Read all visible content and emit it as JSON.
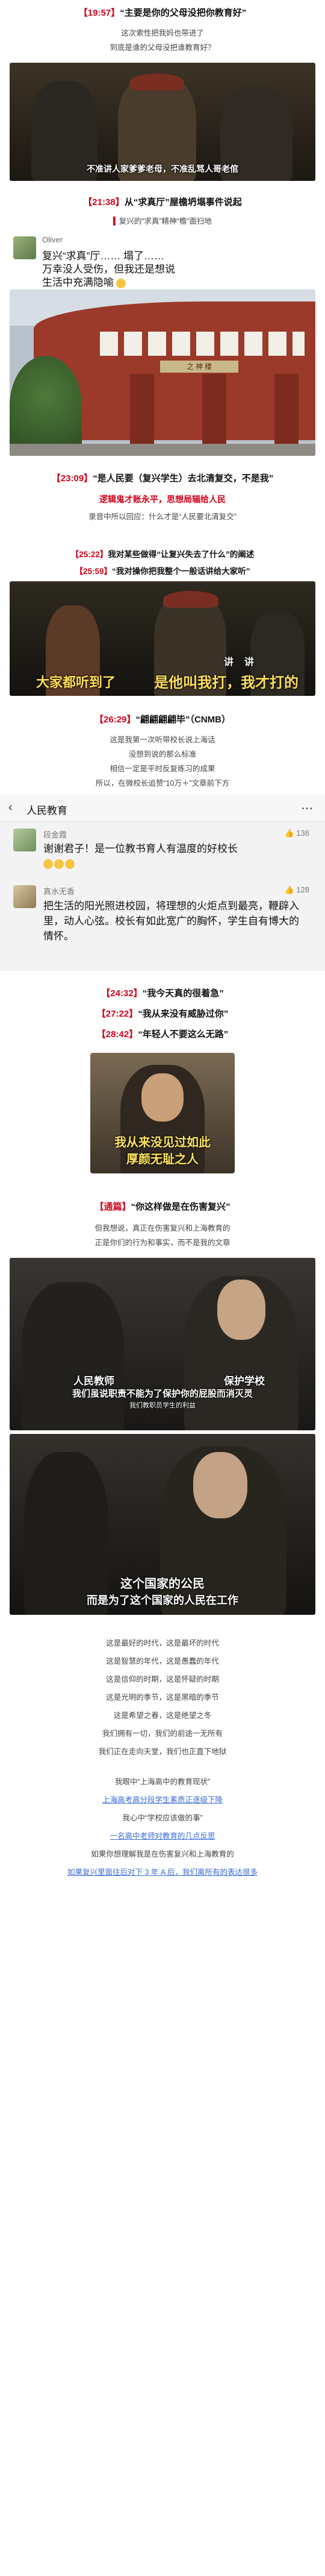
{
  "sec1": {
    "time": "19:57",
    "title_text": "“主要是你的父母没把你教育好”",
    "lines": [
      "这次索性把我妈也带进了",
      "到底是谁的父母没把谁教育好？"
    ],
    "subtitle": "不准讲人家爹爹老母，不准乱骂人哥老倌"
  },
  "sec2": {
    "time": "21:38",
    "title_text": "从“求真厅”屋檐坍塌事件说起",
    "note": "复兴的“求真”精神“檐”面扫地",
    "user": "Oliver",
    "comment": [
      "复兴“求真”厅…… 塌了……",
      "万幸没人受伤，但我还是想说",
      "生活中充满隐喻"
    ],
    "sign": "之 神 楼"
  },
  "sec3": {
    "time": "23:09",
    "title_text": "“是人民要（复兴学生）去北清复交，不是我”",
    "quote": [
      "逻辑鬼才账永平，思想局辐给人民"
    ],
    "note": "录音中所以回应：什么才是“人民要北清复交”"
  },
  "sec4": {
    "rows": [
      {
        "time": "25:22",
        "text": "我对某些做得“让复兴失去了什么”的阐述"
      },
      {
        "time": "25:59",
        "text": "“我对操你把我整个一般话讲给大家听”"
      }
    ],
    "subtitle_left": "大家都听到了",
    "subtitle_right": "讲讲",
    "subtitle_main": "是他叫我打，我才打的"
  },
  "sec5": {
    "time": "26:29",
    "title_text": "“翩翩翩翩毕”（CNMB）",
    "lines": [
      "这是我第一次听带校长说上海话",
      "没想到说的那么标准",
      "相信一定是平时反复练习的成果"
    ],
    "last_prefix": "所以，在微校长追赞“10万＋”文章前下方"
  },
  "app": {
    "back_icon": "chevron-left",
    "title": "人民教育",
    "menu_label": "⋯",
    "comments": [
      {
        "user": "段金霞",
        "likes": "136",
        "text": [
          "谢谢君子！是一位教书育人有温度的好校长"
        ],
        "emoji": 3
      },
      {
        "user": "真水无香",
        "likes": "128",
        "text": [
          "把生活的阳光照进校园，将理想的火炬点到最亮，鞭辟入里，动人心弦。校长有如此宽广的胸怀，学生自有博大的情怀。"
        ],
        "emoji": 0
      }
    ]
  },
  "sec6": {
    "rows": [
      {
        "time": "24:32",
        "text": "“我今天真的很着急”"
      },
      {
        "time": "27:22",
        "text": "“我从来没有威胁过你”"
      },
      {
        "time": "28:42",
        "text": "“年轻人不要这么无路”"
      }
    ],
    "subtitle_a": "我从来没见过如此",
    "subtitle_b": "厚颜无耻之人"
  },
  "sec7": {
    "tag": "通篇",
    "title_text": "“你这样做是在伤害复兴”",
    "lines": [
      "但我想说，真正在伤害复兴和上海教育的",
      "正是你们的行为和事实，而不是我的文章"
    ],
    "frame1_left": "人民教师",
    "frame1_right": "保护学校",
    "frame1_sub": "我们虽说职责不能为了保护你的屁股而消灭灵",
    "frame1_small": "我们教职员学生的利益",
    "frame2_sub1": "这个国家的公民",
    "frame2_sub2": "而是为了这个国家的人民在工作"
  },
  "poem": {
    "lines": [
      "这是最好的时代，这是最坏的时代",
      "这是智慧的年代，这是愚蠢的年代",
      "这是信仰的时期，这是怀疑的时期",
      "这是光明的季节，这是黑暗的季节",
      "这是希望之春，这是绝望之冬",
      "我们拥有一切，我们的前途一无所有",
      "我们正在走向天堂，我们也正直下地狱"
    ]
  },
  "footer": {
    "lines": [
      {
        "text": "我眼中“上海高中的教育现状”",
        "link": false
      },
      {
        "text": "上海高考高分段学生素质正逐级下降",
        "link": true
      },
      {
        "text": "我心中“学校应该做的事”",
        "link": false
      },
      {
        "text": "一名高中老师对教育的几点反思",
        "link": true
      },
      {
        "text": "如果你想理解我是在伤害复兴和上海教育的",
        "link": false
      },
      {
        "text": "如果复兴里面往后对下 3 年 A 后，我们离所有的表达很多",
        "link": true
      }
    ]
  }
}
